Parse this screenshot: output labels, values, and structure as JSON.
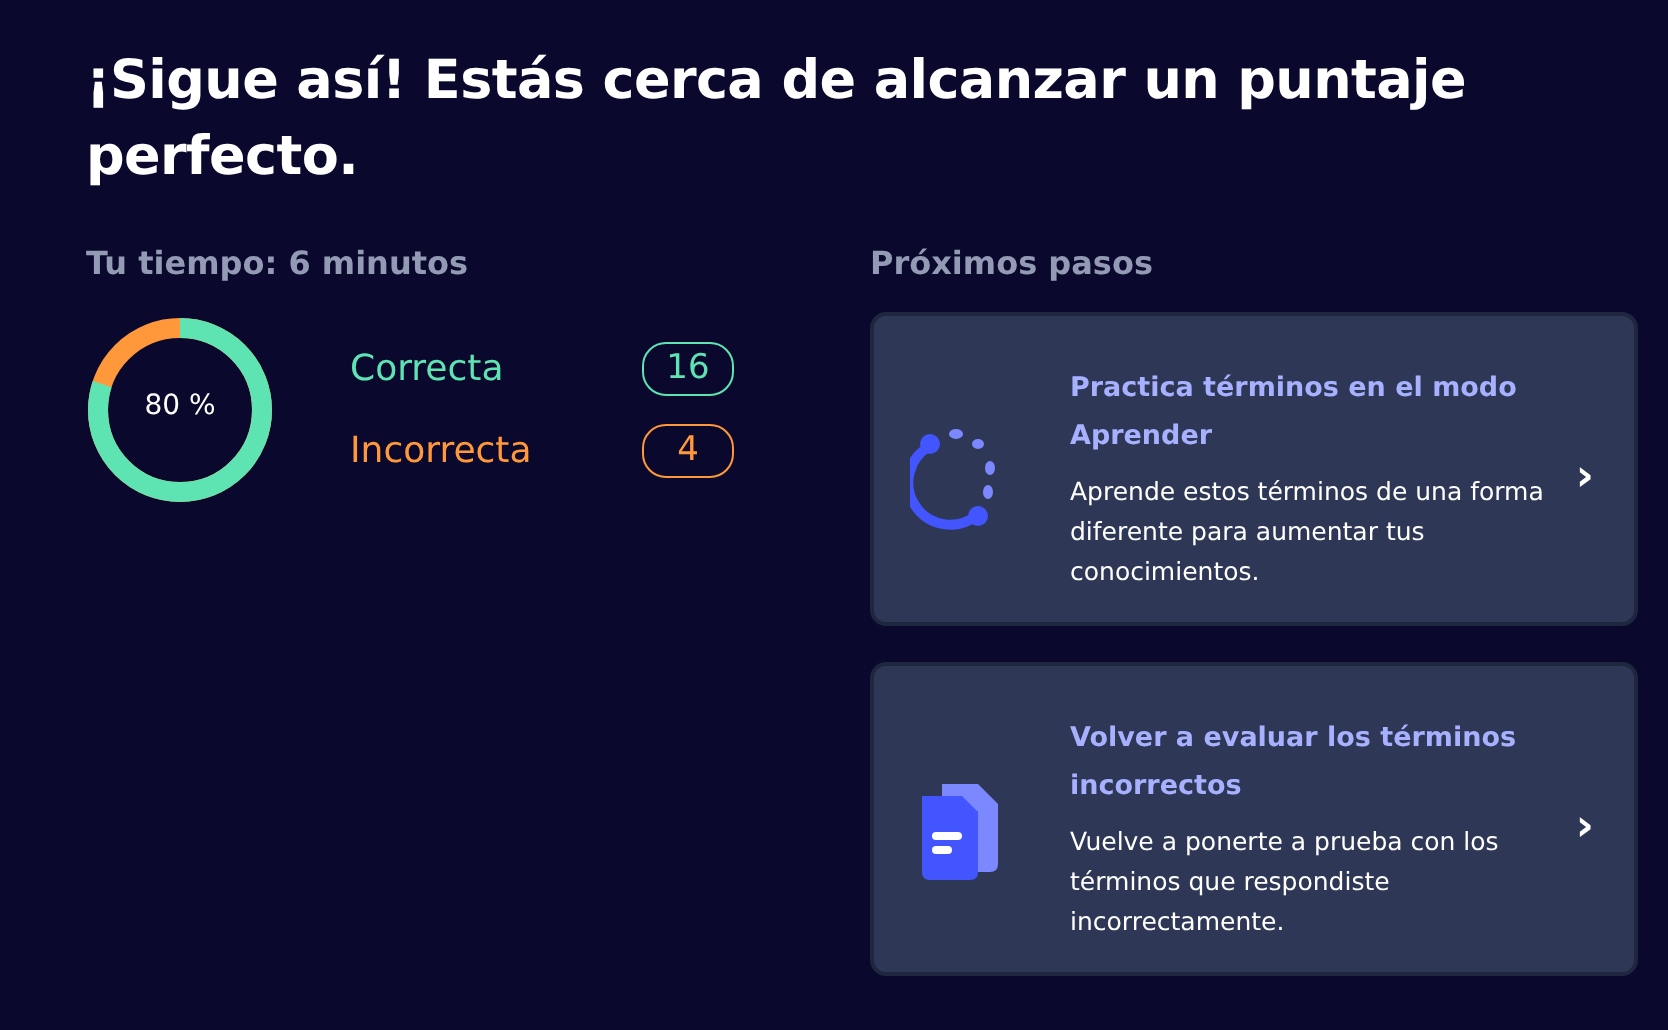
{
  "heading": "¡Sigue así! Estás cerca de alcanzar un puntaje perfecto.",
  "time_label": "Tu tiempo: 6 minutos",
  "score": {
    "label": "80 %"
  },
  "stats": [
    {
      "label": "Correcta",
      "count": "16",
      "color": "#5ee3b2"
    },
    {
      "label": "Incorrecta",
      "count": "4",
      "color": "#ff983a"
    }
  ],
  "next_steps": {
    "title": "Próximos pasos",
    "items": [
      {
        "kind": "learn",
        "title": "Practica términos en el modo Aprender",
        "description": "Aprende estos términos de una forma diferente para aumentar tus conocimientos.",
        "arrow": "›"
      },
      {
        "kind": "retest",
        "title": "Volver a evaluar los términos incorrectos",
        "description": "Vuelve a ponerte a prueba con los términos que respondiste incorrectamente.",
        "arrow": "›"
      }
    ]
  }
}
